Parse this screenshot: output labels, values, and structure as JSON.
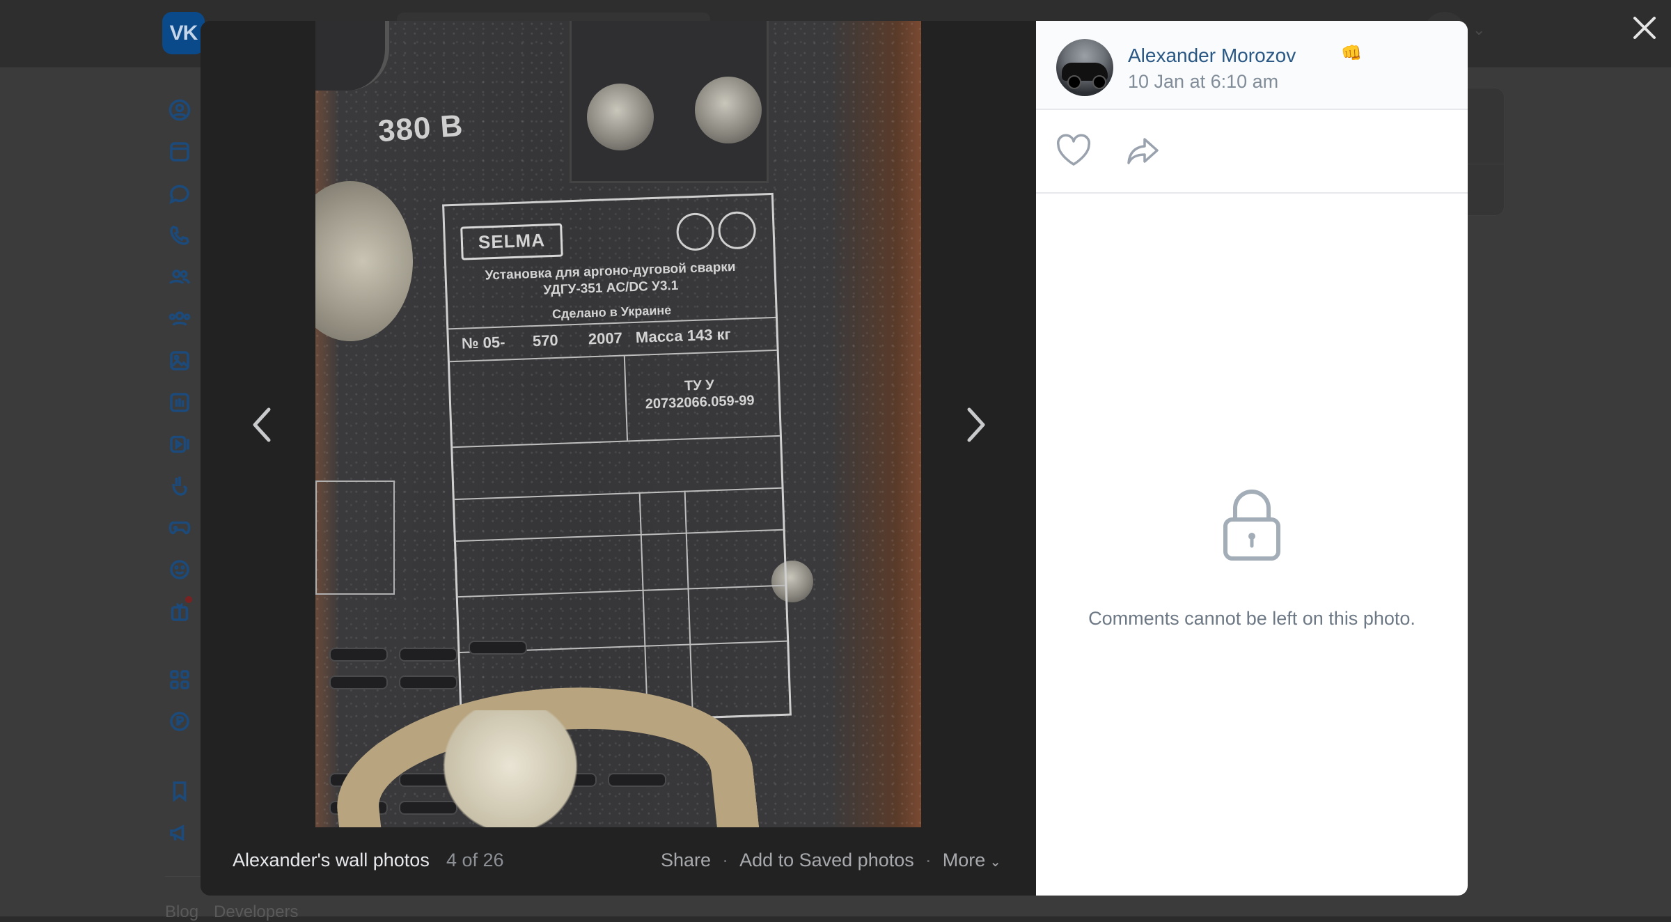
{
  "header": {
    "logo_text": "VK"
  },
  "footer_links": [
    "Blog",
    "Developers"
  ],
  "viewer": {
    "album_title": "Alexander's wall photos",
    "photo_counter": "4 of 26",
    "actions": {
      "share": "Share",
      "save": "Add to Saved photos",
      "more": "More"
    }
  },
  "photo_content": {
    "voltage": "380 В",
    "brand": "SELMA",
    "title_line1": "Установка для аргоно-дуговой сварки",
    "title_line2": "УДГУ-351 AC/DC У3.1",
    "made_in": "Сделано в Украине",
    "serial_label": "№ 05-",
    "serial_value": "570",
    "year": "2007",
    "mass": "Масса 143 кг",
    "tu_line1": "ТУ У",
    "tu_line2": "20732066.059-99"
  },
  "post": {
    "author": "Alexander Morozov",
    "author_emoji": "👊",
    "date": "10 Jan at 6:10 am",
    "comments_disabled": "Comments cannot be left on this photo."
  },
  "colors": {
    "link": "#2a5885",
    "muted": "#818c99",
    "overlay": "#222222"
  }
}
